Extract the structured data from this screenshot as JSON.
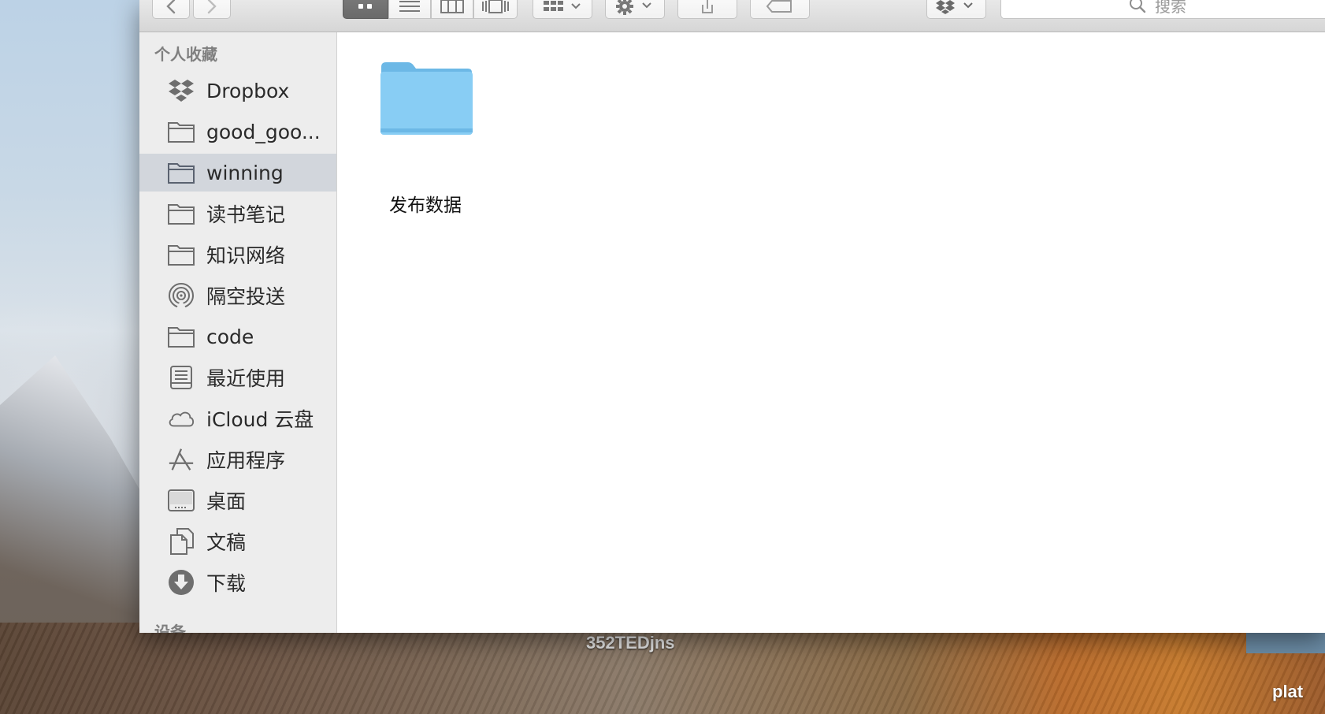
{
  "window": {
    "toolbar": {
      "back_icon": "chevron-left-icon",
      "forward_icon": "chevron-right-icon",
      "view_icon_mode": "icon-view",
      "view_list_mode": "list-view",
      "view_column_mode": "column-view",
      "view_gallery_mode": "cover-flow-view",
      "arrange_icon": "arrange-grid-icon",
      "action_icon": "gear-icon",
      "share_icon": "share-icon",
      "tag_icon": "tag-icon",
      "dropbox_icon": "dropbox-icon",
      "search": {
        "placeholder": "搜索"
      }
    },
    "sidebar": {
      "favorites_header": "个人收藏",
      "items": [
        {
          "label": "Dropbox",
          "icon": "dropbox-icon",
          "selected": false
        },
        {
          "label": "good_goo...",
          "icon": "folder-icon",
          "selected": false
        },
        {
          "label": "winning",
          "icon": "folder-icon",
          "selected": true
        },
        {
          "label": "读书笔记",
          "icon": "folder-icon",
          "selected": false
        },
        {
          "label": "知识网络",
          "icon": "folder-icon",
          "selected": false
        },
        {
          "label": "隔空投送",
          "icon": "airdrop-icon",
          "selected": false
        },
        {
          "label": "code",
          "icon": "folder-icon",
          "selected": false
        },
        {
          "label": "最近使用",
          "icon": "recents-icon",
          "selected": false
        },
        {
          "label": "iCloud 云盘",
          "icon": "cloud-icon",
          "selected": false
        },
        {
          "label": "应用程序",
          "icon": "applications-icon",
          "selected": false
        },
        {
          "label": "桌面",
          "icon": "desktop-icon",
          "selected": false
        },
        {
          "label": "文稿",
          "icon": "documents-icon",
          "selected": false
        },
        {
          "label": "下载",
          "icon": "download-icon",
          "selected": false
        }
      ],
      "devices_header": "设备"
    },
    "content": {
      "items": [
        {
          "name": "发布数据",
          "type": "folder",
          "color": "#7cc4ef"
        }
      ]
    }
  },
  "desktop": {
    "label_center": "352TEDjns",
    "label_right": "plat"
  }
}
